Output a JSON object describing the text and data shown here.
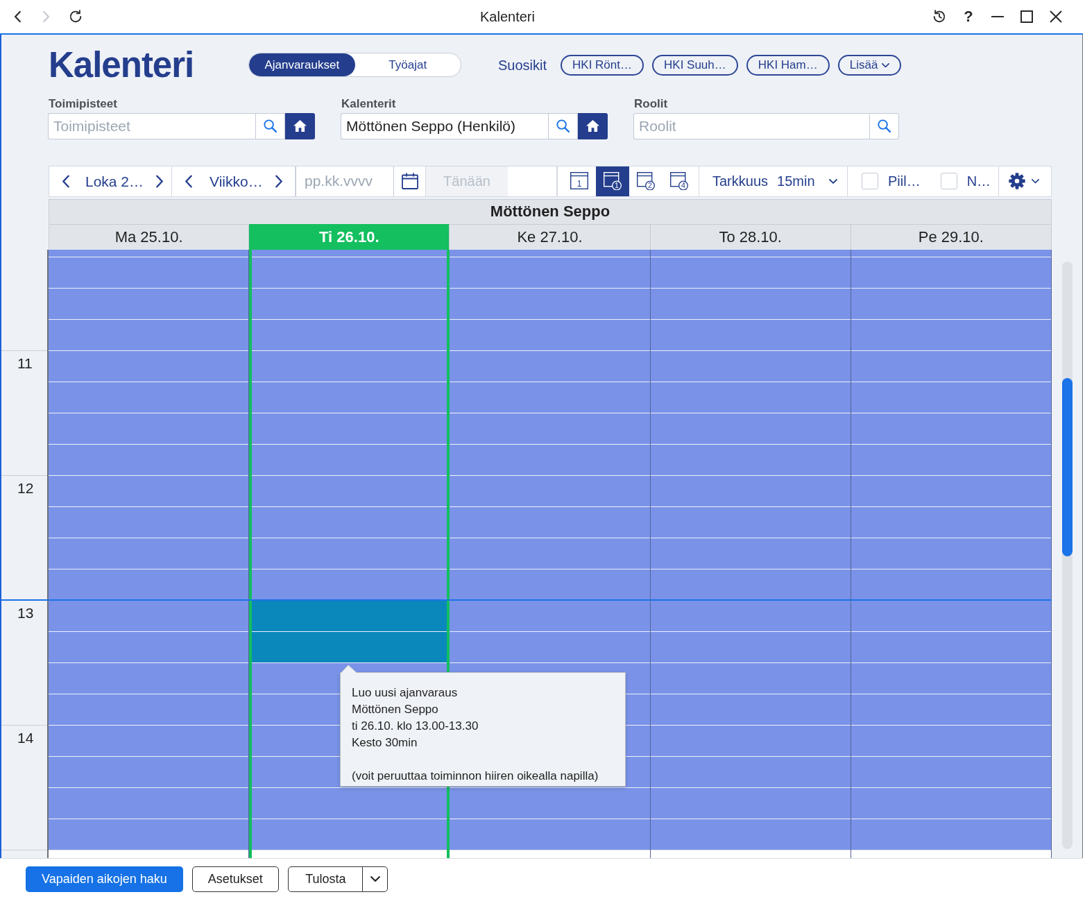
{
  "window": {
    "title": "Kalenteri",
    "help": "?"
  },
  "header": {
    "title": "Kalenteri",
    "modes": [
      {
        "label": "Ajanvaraukset",
        "selected": true
      },
      {
        "label": "Työajat",
        "selected": false
      }
    ],
    "favorites_label": "Suosikit",
    "favorites": [
      {
        "label": "HKI Rönt…",
        "kind": "favorite"
      },
      {
        "label": "HKI Suuh…",
        "kind": "favorite"
      },
      {
        "label": "HKI Ham…",
        "kind": "favorite"
      },
      {
        "label": "Lisää",
        "kind": "more"
      }
    ]
  },
  "filters": [
    {
      "label": "Toimipisteet",
      "placeholder": "Toimipisteet",
      "home_button": true
    },
    {
      "label": "Kalenterit",
      "value": "Möttönen Seppo (Henkilö)",
      "home_button": true
    },
    {
      "label": "Roolit",
      "placeholder": "Roolit",
      "home_button": false
    }
  ],
  "toolbar": {
    "month": "Loka 2…",
    "week": "Viikko…",
    "date_placeholder": "pp.kk.vvvv",
    "today": {
      "label": "Tänään",
      "disabled": true
    },
    "views": [
      {
        "kind": "day",
        "number": "1",
        "selected": false
      },
      {
        "kind": "week",
        "number": "1",
        "selected": true
      },
      {
        "kind": "week",
        "number": "2",
        "selected": false
      },
      {
        "kind": "week",
        "number": "4",
        "selected": false
      }
    ],
    "precision_label": "Tarkkuus",
    "precision": "15min",
    "checkboxes": [
      {
        "label": "Piil…",
        "checked": false
      },
      {
        "label": "N…",
        "checked": false
      }
    ]
  },
  "calendar": {
    "person": "Möttönen Seppo",
    "days": [
      {
        "label": "Ma 25.10.",
        "selected": false
      },
      {
        "label": "Ti 26.10.",
        "selected": true
      },
      {
        "label": "Ke 27.10.",
        "selected": false
      },
      {
        "label": "To 28.10.",
        "selected": false
      },
      {
        "label": "Pe 29.10.",
        "selected": false
      }
    ],
    "hours": [
      {
        "label": "11",
        "current": false,
        "selected_slots": [
          false,
          false,
          false,
          false
        ]
      },
      {
        "label": "12",
        "current": false,
        "selected_slots": [
          false,
          false,
          false,
          false
        ]
      },
      {
        "label": "13",
        "current": true,
        "selected_slots": [
          true,
          true,
          false,
          false
        ]
      },
      {
        "label": "14",
        "current": false,
        "selected_slots": [
          false,
          false,
          false,
          false
        ]
      }
    ]
  },
  "tooltip": {
    "lines": [
      "Luo uusi ajanvaraus",
      "Möttönen Seppo",
      "ti 26.10. klo 13.00-13.30",
      "Kesto 30min"
    ],
    "note": "(voit peruuttaa toiminnon hiiren oikealla napilla)"
  },
  "footer": {
    "buttons": [
      {
        "label": "Vapaiden aikojen haku",
        "kind": "primary"
      },
      {
        "label": "Asetukset",
        "kind": "outline"
      },
      {
        "label": "Tulosta",
        "kind": "split"
      }
    ]
  }
}
